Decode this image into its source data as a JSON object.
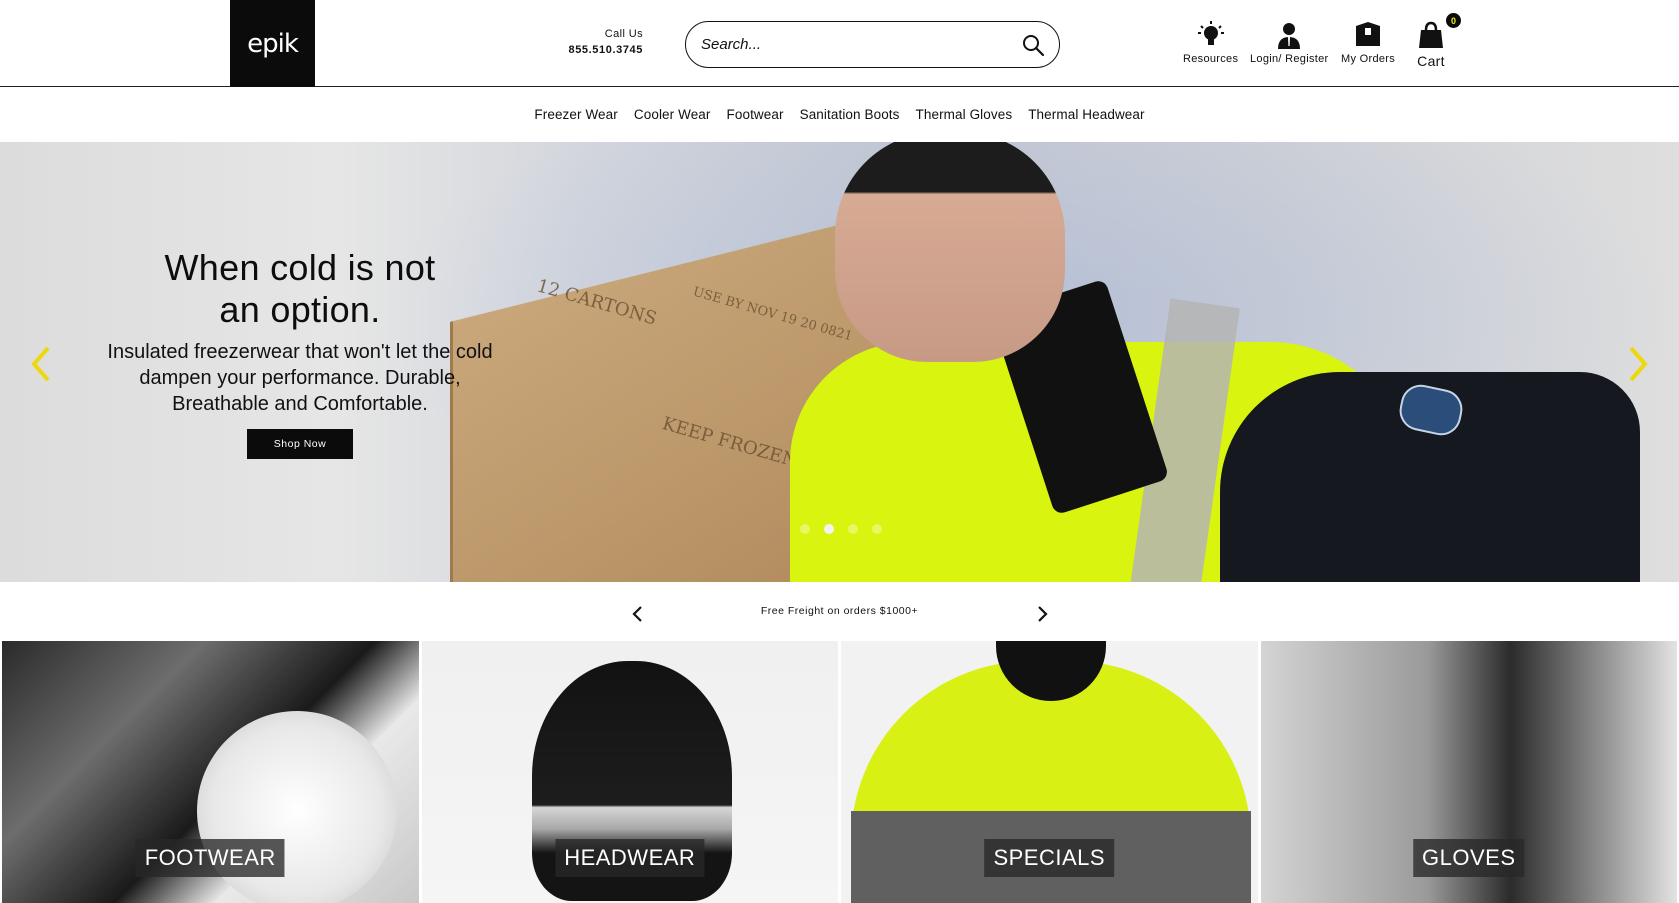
{
  "header": {
    "logo_text": "epik",
    "call_label": "Call Us",
    "call_number": "855.510.3745",
    "search_placeholder": "Search...",
    "resources_label": "Resources",
    "login_label": "Login/ Register",
    "orders_label": "My Orders",
    "cart_label": "Cart",
    "cart_count": "0"
  },
  "nav": {
    "items": [
      {
        "label": "Freezer Wear"
      },
      {
        "label": "Cooler Wear"
      },
      {
        "label": "Footwear"
      },
      {
        "label": "Sanitation Boots"
      },
      {
        "label": "Thermal Gloves"
      },
      {
        "label": "Thermal Headwear"
      }
    ]
  },
  "hero": {
    "title_line1": "When cold is not",
    "title_line2": "an option.",
    "subtitle": "Insulated freezerwear that won't let the cold dampen your performance. Durable, Breathable and Comfortable.",
    "button_label": "Shop Now",
    "box_text_1": "12 CARTONS",
    "box_text_2": "USE BY NOV 19 20 0821",
    "box_text_3": "KEEP FROZEN",
    "slide_count": 4,
    "active_slide": 2
  },
  "promo": {
    "text": "Free Freight on orders $1000+"
  },
  "tiles": [
    {
      "label": "FOOTWEAR"
    },
    {
      "label": "HEADWEAR"
    },
    {
      "label": "SPECIALS"
    },
    {
      "label": "GLOVES"
    }
  ],
  "colors": {
    "accent_yellow": "#e7f31b",
    "brand_black": "#0b0b0b",
    "hi_vis": "#d9f40f"
  }
}
